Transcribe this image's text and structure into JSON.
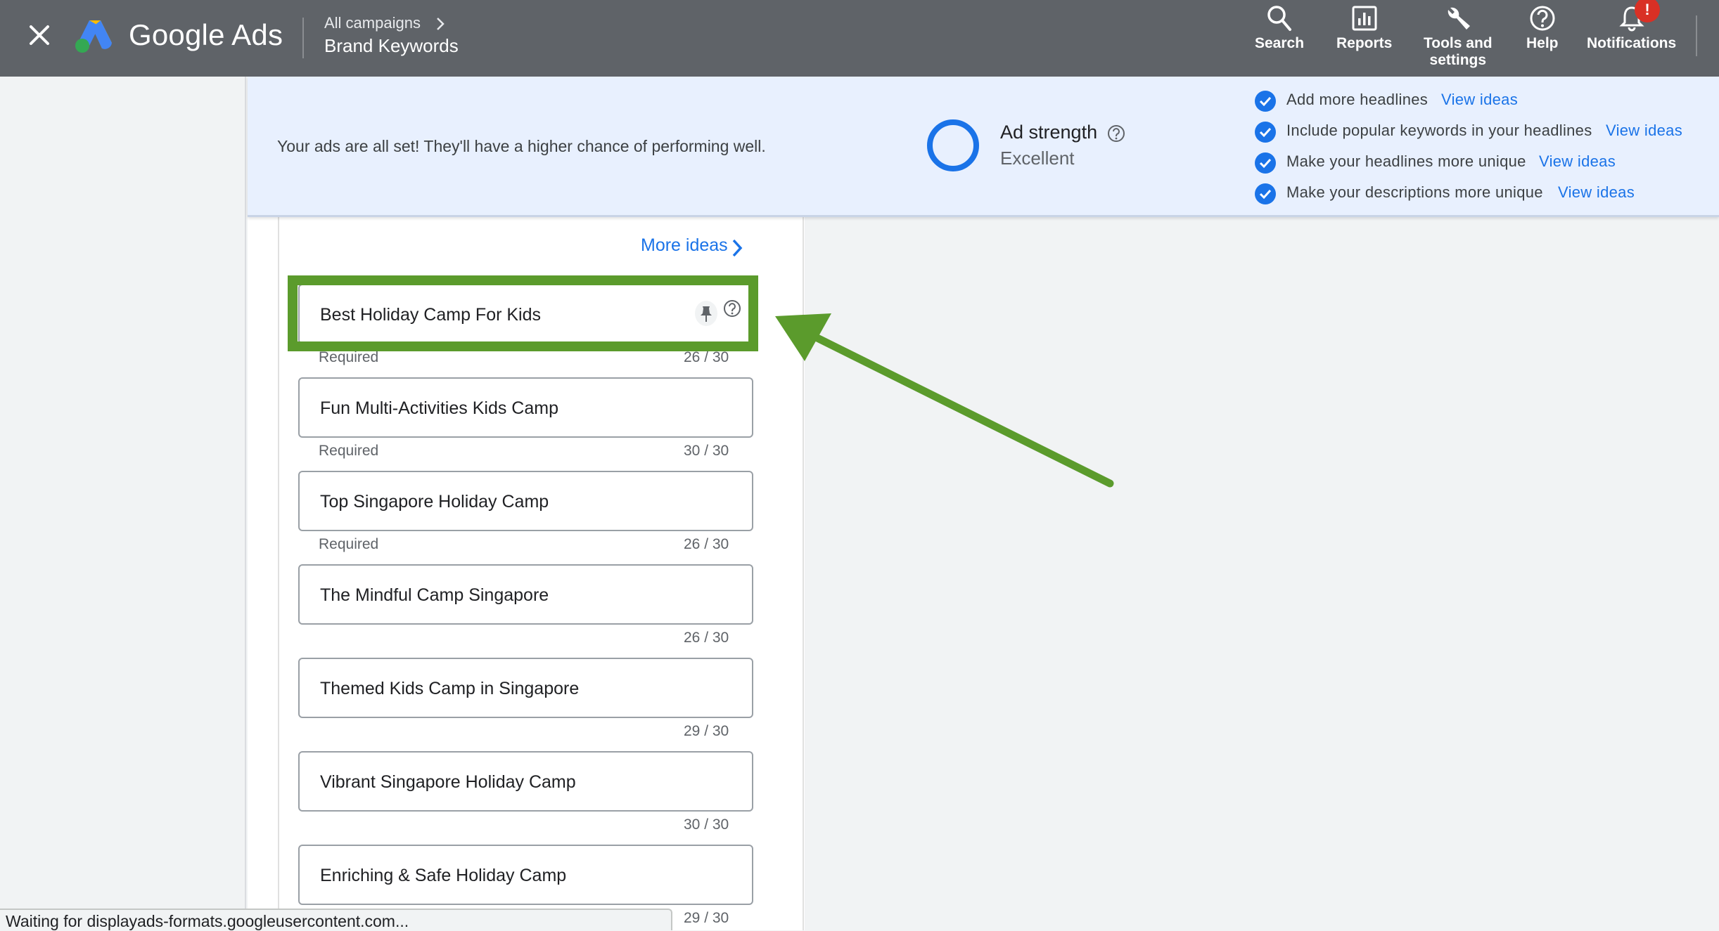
{
  "header": {
    "brand": "Google Ads",
    "breadcrumb_parent": "All campaigns",
    "breadcrumb_current": "Brand Keywords",
    "nav": [
      {
        "label": "Search",
        "icon": "search-icon"
      },
      {
        "label": "Reports",
        "icon": "reports-icon"
      },
      {
        "label": "Tools and",
        "label2": "settings",
        "icon": "wrench-icon"
      },
      {
        "label": "Help",
        "icon": "help-icon"
      },
      {
        "label": "Notifications",
        "icon": "bell-icon",
        "badge": "!"
      }
    ]
  },
  "banner": {
    "message": "Your ads are all set! They'll have a higher chance of performing well.",
    "ad_strength_title": "Ad strength",
    "ad_strength_value": "Excellent",
    "tips": [
      {
        "text": "Add more headlines",
        "link": "View ideas"
      },
      {
        "text": "Include popular keywords in your headlines",
        "link": "View ideas"
      },
      {
        "text": "Make your headlines more unique",
        "link": "View ideas"
      },
      {
        "text": "Make your descriptions more unique",
        "link": "View ideas"
      }
    ]
  },
  "headlines": {
    "more_ideas": "More ideas",
    "items": [
      {
        "value": "Best Holiday Camp For Kids",
        "helper": "Required",
        "count": "26 / 30"
      },
      {
        "value": "Fun Multi-Activities Kids Camp",
        "helper": "Required",
        "count": "30 / 30"
      },
      {
        "value": "Top Singapore Holiday Camp",
        "helper": "Required",
        "count": "26 / 30"
      },
      {
        "value": "The Mindful Camp Singapore",
        "helper": "",
        "count": "26 / 30"
      },
      {
        "value": "Themed Kids Camp in Singapore",
        "helper": "",
        "count": "29 / 30"
      },
      {
        "value": "Vibrant Singapore Holiday Camp",
        "helper": "",
        "count": "30 / 30"
      },
      {
        "value": "Enriching & Safe Holiday Camp",
        "helper": "",
        "count": "29 / 30"
      }
    ]
  },
  "status_bar": "Waiting for displayads-formats.googleusercontent.com...",
  "colors": {
    "topbar": "#5f6368",
    "accent": "#1a73e8",
    "highlight": "#5b9b2c",
    "banner": "#e8f0fe"
  }
}
